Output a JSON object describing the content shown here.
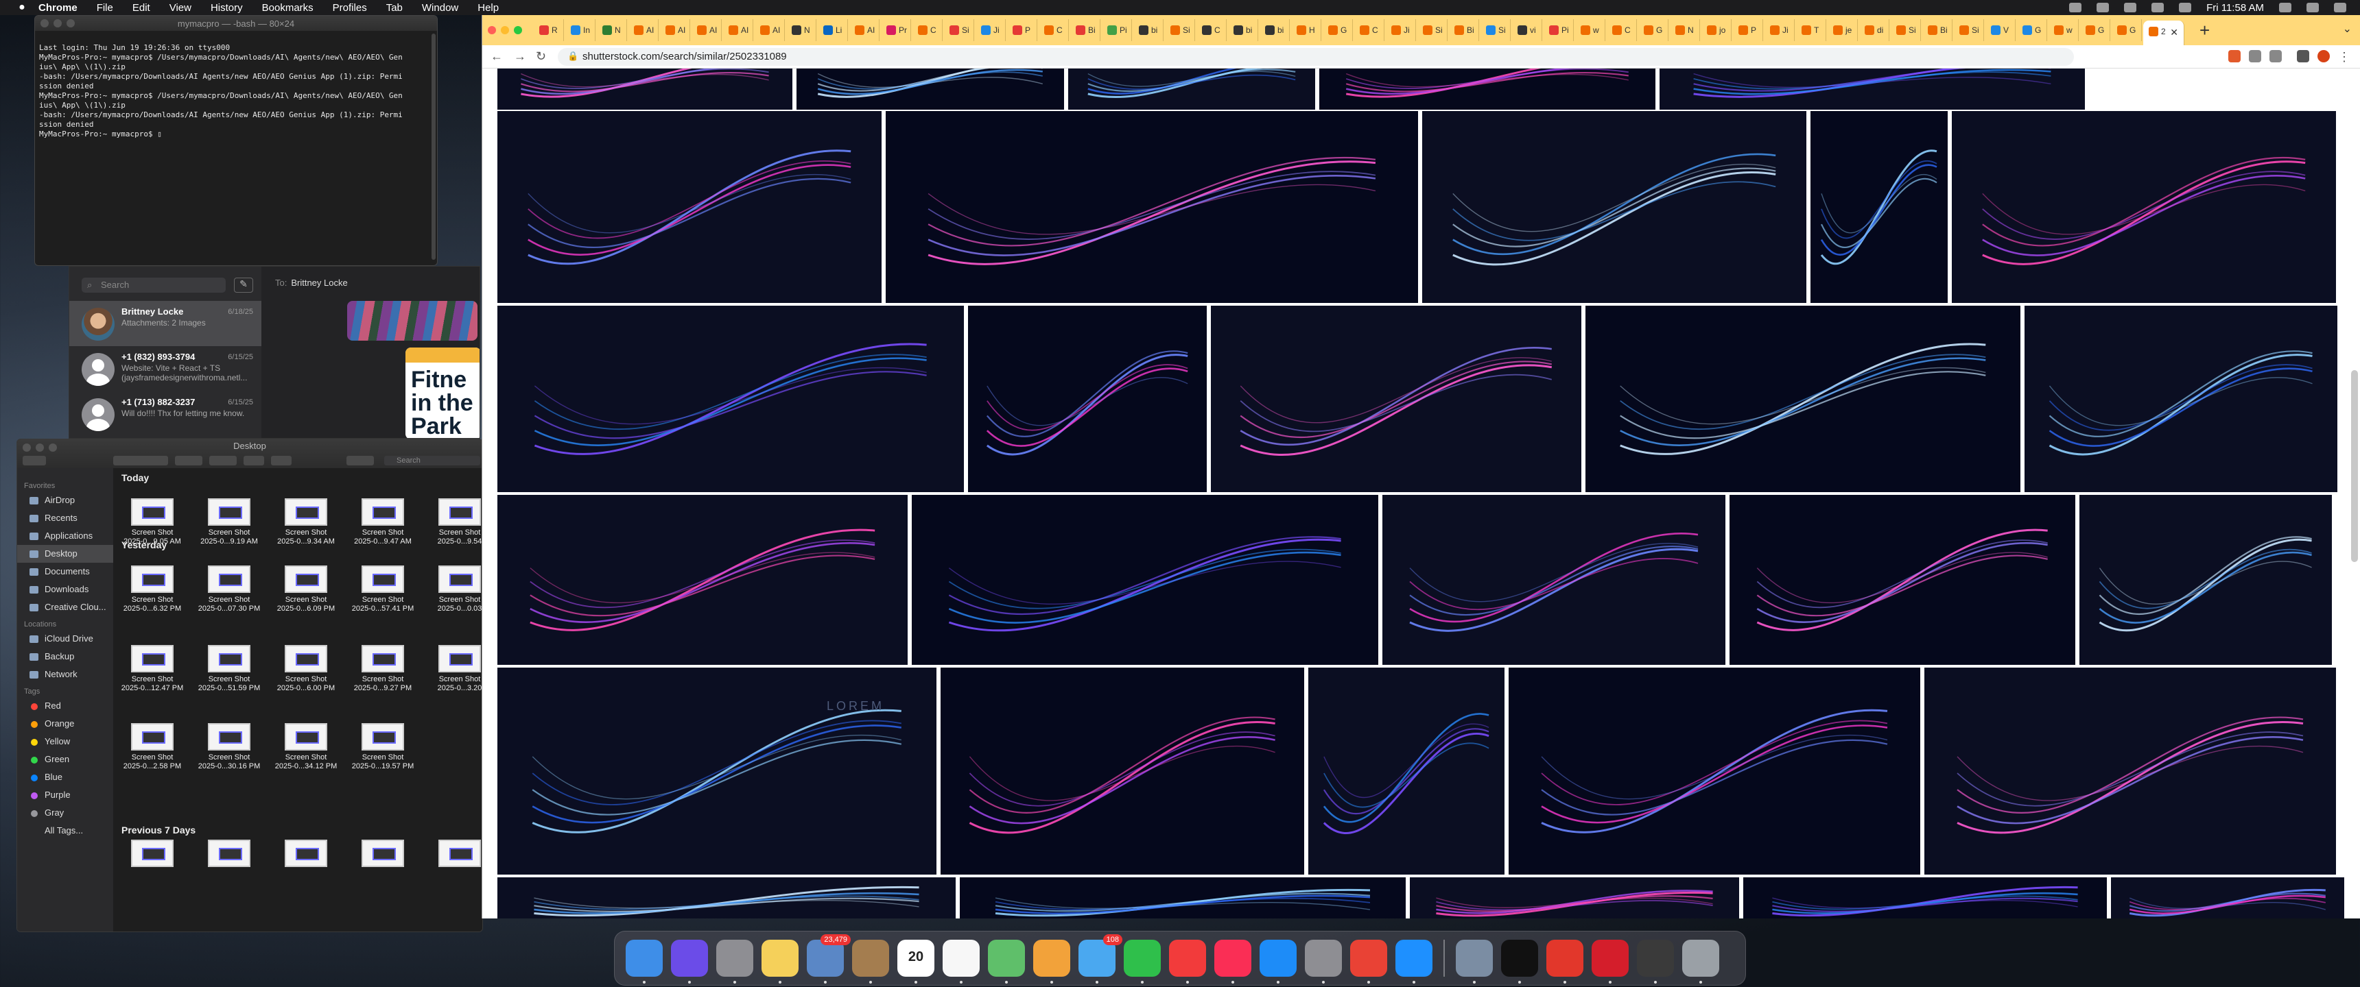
{
  "menubar": {
    "app": "Chrome",
    "items": [
      "File",
      "Edit",
      "View",
      "History",
      "Bookmarks",
      "Profiles",
      "Tab",
      "Window",
      "Help"
    ],
    "clock": "Fri 11:58 AM"
  },
  "terminal": {
    "title": "mymacpro — -bash — 80×24",
    "lines": [
      "Last login: Thu Jun 19 19:26:36 on ttys000",
      "MyMacPros-Pro:~ mymacpro$ /Users/mymacpro/Downloads/AI\\ Agents/new\\ AEO/AEO\\ Gen",
      "ius\\ App\\ \\(1\\).zip",
      "-bash: /Users/mymacpro/Downloads/AI Agents/new AEO/AEO Genius App (1).zip: Permi",
      "ssion denied",
      "MyMacPros-Pro:~ mymacpro$ /Users/mymacpro/Downloads/AI\\ Agents/new\\ AEO/AEO\\ Gen",
      "ius\\ App\\ \\(1\\).zip",
      "-bash: /Users/mymacpro/Downloads/AI Agents/new AEO/AEO Genius App (1).zip: Permi",
      "ssion denied",
      "MyMacPros-Pro:~ mymacpro$ ▯"
    ]
  },
  "messages": {
    "search_placeholder": "Search",
    "to_label": "To:",
    "to_name": "Brittney Locke",
    "conversations": [
      {
        "name": "Brittney Locke",
        "date": "6/18/25",
        "preview": "Attachments: 2 Images"
      },
      {
        "name": "+1 (832) 893-3794",
        "date": "6/15/25",
        "preview": "Website: Vite + React + TS (jaysframedesignerwithroma.netl..."
      },
      {
        "name": "+1 (713) 882-3237",
        "date": "6/15/25",
        "preview": "Will do!!!! Thx for letting me know."
      }
    ],
    "poster_text": "Fitne in the Park"
  },
  "finder": {
    "title": "Desktop",
    "search_placeholder": "Search",
    "favorites_header": "Favorites",
    "favorites": [
      "AirDrop",
      "Recents",
      "Applications",
      "Desktop",
      "Documents",
      "Downloads",
      "Creative Clou..."
    ],
    "locations_header": "Locations",
    "locations": [
      "iCloud Drive",
      "Backup",
      "Network"
    ],
    "tags_header": "Tags",
    "tags": [
      {
        "name": "Red",
        "color": "#ff453a"
      },
      {
        "name": "Orange",
        "color": "#ff9f0a"
      },
      {
        "name": "Yellow",
        "color": "#ffd60a"
      },
      {
        "name": "Green",
        "color": "#32d74b"
      },
      {
        "name": "Blue",
        "color": "#0a84ff"
      },
      {
        "name": "Purple",
        "color": "#bf5af2"
      },
      {
        "name": "Gray",
        "color": "#98989d"
      },
      {
        "name": "All Tags...",
        "color": ""
      }
    ],
    "sections": [
      {
        "title": "Today",
        "files": [
          [
            "Screen Shot",
            "2025-0...9.05 AM"
          ],
          [
            "Screen Shot",
            "2025-0...9.19 AM"
          ],
          [
            "Screen Shot",
            "2025-0...9.34 AM"
          ],
          [
            "Screen Shot",
            "2025-0...9.47 AM"
          ],
          [
            "Screen Shot",
            "2025-0...9.54"
          ]
        ]
      },
      {
        "title": "Yesterday",
        "files": [
          [
            "Screen Shot",
            "2025-0...6.32 PM"
          ],
          [
            "Screen Shot",
            "2025-0...07.30 PM"
          ],
          [
            "Screen Shot",
            "2025-0...6.09 PM"
          ],
          [
            "Screen Shot",
            "2025-0...57.41 PM"
          ],
          [
            "Screen Shot",
            "2025-0...0.03"
          ],
          [
            "Screen Shot",
            "2025-0...12.47 PM"
          ],
          [
            "Screen Shot",
            "2025-0...51.59 PM"
          ],
          [
            "Screen Shot",
            "2025-0...6.00 PM"
          ],
          [
            "Screen Shot",
            "2025-0...9.27 PM"
          ],
          [
            "Screen Shot",
            "2025-0...3.20"
          ],
          [
            "Screen Shot",
            "2025-0...2.58 PM"
          ],
          [
            "Screen Shot",
            "2025-0...30.16 PM"
          ],
          [
            "Screen Shot",
            "2025-0...34.12 PM"
          ],
          [
            "Screen Shot",
            "2025-0...19.57 PM"
          ]
        ]
      },
      {
        "title": "Previous 7 Days",
        "files": []
      }
    ]
  },
  "chrome": {
    "url": "shutterstock.com/search/similar/2502331089",
    "tabs": [
      {
        "l": "R",
        "c": "#e53935"
      },
      {
        "l": "In",
        "c": "#1e88e5"
      },
      {
        "l": "N",
        "c": "#2e7d32"
      },
      {
        "l": "AI",
        "c": "#ef6c00"
      },
      {
        "l": "AI",
        "c": "#ef6c00"
      },
      {
        "l": "AI",
        "c": "#ef6c00"
      },
      {
        "l": "AI",
        "c": "#ef6c00"
      },
      {
        "l": "AI",
        "c": "#ef6c00"
      },
      {
        "l": "N",
        "c": "#333"
      },
      {
        "l": "Li",
        "c": "#0a66c2"
      },
      {
        "l": "AI",
        "c": "#ef6c00"
      },
      {
        "l": "Pr",
        "c": "#d81b60"
      },
      {
        "l": "C",
        "c": "#ef6c00"
      },
      {
        "l": "Si",
        "c": "#e53935"
      },
      {
        "l": "Ji",
        "c": "#1e88e5"
      },
      {
        "l": "P",
        "c": "#e53935"
      },
      {
        "l": "C",
        "c": "#ef6c00"
      },
      {
        "l": "Bi",
        "c": "#e53935"
      },
      {
        "l": "Pi",
        "c": "#43a047"
      },
      {
        "l": "bi",
        "c": "#333"
      },
      {
        "l": "Si",
        "c": "#ef6c00"
      },
      {
        "l": "C",
        "c": "#333"
      },
      {
        "l": "bi",
        "c": "#333"
      },
      {
        "l": "bi",
        "c": "#333"
      },
      {
        "l": "H",
        "c": "#ef6c00"
      },
      {
        "l": "G",
        "c": "#ef6c00"
      },
      {
        "l": "C",
        "c": "#ef6c00"
      },
      {
        "l": "Ji",
        "c": "#ef6c00"
      },
      {
        "l": "Si",
        "c": "#ef6c00"
      },
      {
        "l": "Bi",
        "c": "#ef6c00"
      },
      {
        "l": "Si",
        "c": "#1e88e5"
      },
      {
        "l": "vi",
        "c": "#333"
      },
      {
        "l": "Pi",
        "c": "#e53935"
      },
      {
        "l": "w",
        "c": "#ef6c00"
      },
      {
        "l": "C",
        "c": "#ef6c00"
      },
      {
        "l": "G",
        "c": "#ef6c00"
      },
      {
        "l": "N",
        "c": "#ef6c00"
      },
      {
        "l": "jo",
        "c": "#ef6c00"
      },
      {
        "l": "P",
        "c": "#ef6c00"
      },
      {
        "l": "Ji",
        "c": "#ef6c00"
      },
      {
        "l": "T",
        "c": "#ef6c00"
      },
      {
        "l": "je",
        "c": "#ef6c00"
      },
      {
        "l": "di",
        "c": "#ef6c00"
      },
      {
        "l": "Si",
        "c": "#ef6c00"
      },
      {
        "l": "Bi",
        "c": "#ef6c00"
      },
      {
        "l": "Si",
        "c": "#ef6c00"
      },
      {
        "l": "V",
        "c": "#1e88e5"
      },
      {
        "l": "G",
        "c": "#1e88e5"
      },
      {
        "l": "w",
        "c": "#ef6c00"
      },
      {
        "l": "G",
        "c": "#ef6c00"
      },
      {
        "l": "G",
        "c": "#ef6c00"
      },
      {
        "l": "2",
        "c": "#ef6c00"
      }
    ],
    "results_overlay_text": "LOREM"
  },
  "dock": {
    "apps": [
      {
        "name": "Finder",
        "color": "#3e8ee8"
      },
      {
        "name": "Siri",
        "color": "#6b4ce8"
      },
      {
        "name": "Launchpad",
        "color": "#8e8e93"
      },
      {
        "name": "Notes",
        "color": "#f5d05a"
      },
      {
        "name": "Preview",
        "color": "#5a87c6",
        "badge": "23,479"
      },
      {
        "name": "Notefile",
        "color": "#a47d4f"
      },
      {
        "name": "Calendar",
        "color": "#ffffff",
        "label": "20"
      },
      {
        "name": "Reminders",
        "color": "#f7f7f7"
      },
      {
        "name": "Maps",
        "color": "#5fbf6a"
      },
      {
        "name": "Photos",
        "color": "#f2a23a"
      },
      {
        "name": "Messages",
        "color": "#4aa8f0",
        "badge": "108"
      },
      {
        "name": "FaceTime",
        "color": "#2fbf4b"
      },
      {
        "name": "News",
        "color": "#f23b3b"
      },
      {
        "name": "Music",
        "color": "#fa2e55"
      },
      {
        "name": "App Store",
        "color": "#1d8cf8"
      },
      {
        "name": "System Preferences",
        "color": "#8e8e93"
      },
      {
        "name": "Chrome",
        "color": "#e94235"
      },
      {
        "name": "Safari",
        "color": "#1e90ff"
      }
    ],
    "others": [
      {
        "name": "Image Capture",
        "color": "#7b8da3"
      },
      {
        "name": "Terminal",
        "color": "#111111"
      },
      {
        "name": "Creative Cloud",
        "color": "#e2372b"
      },
      {
        "name": "Adobe",
        "color": "#d41e2b"
      },
      {
        "name": "Stacks",
        "color": "#3a3a3a"
      },
      {
        "name": "Trash",
        "color": "#9aa0a6"
      }
    ]
  }
}
